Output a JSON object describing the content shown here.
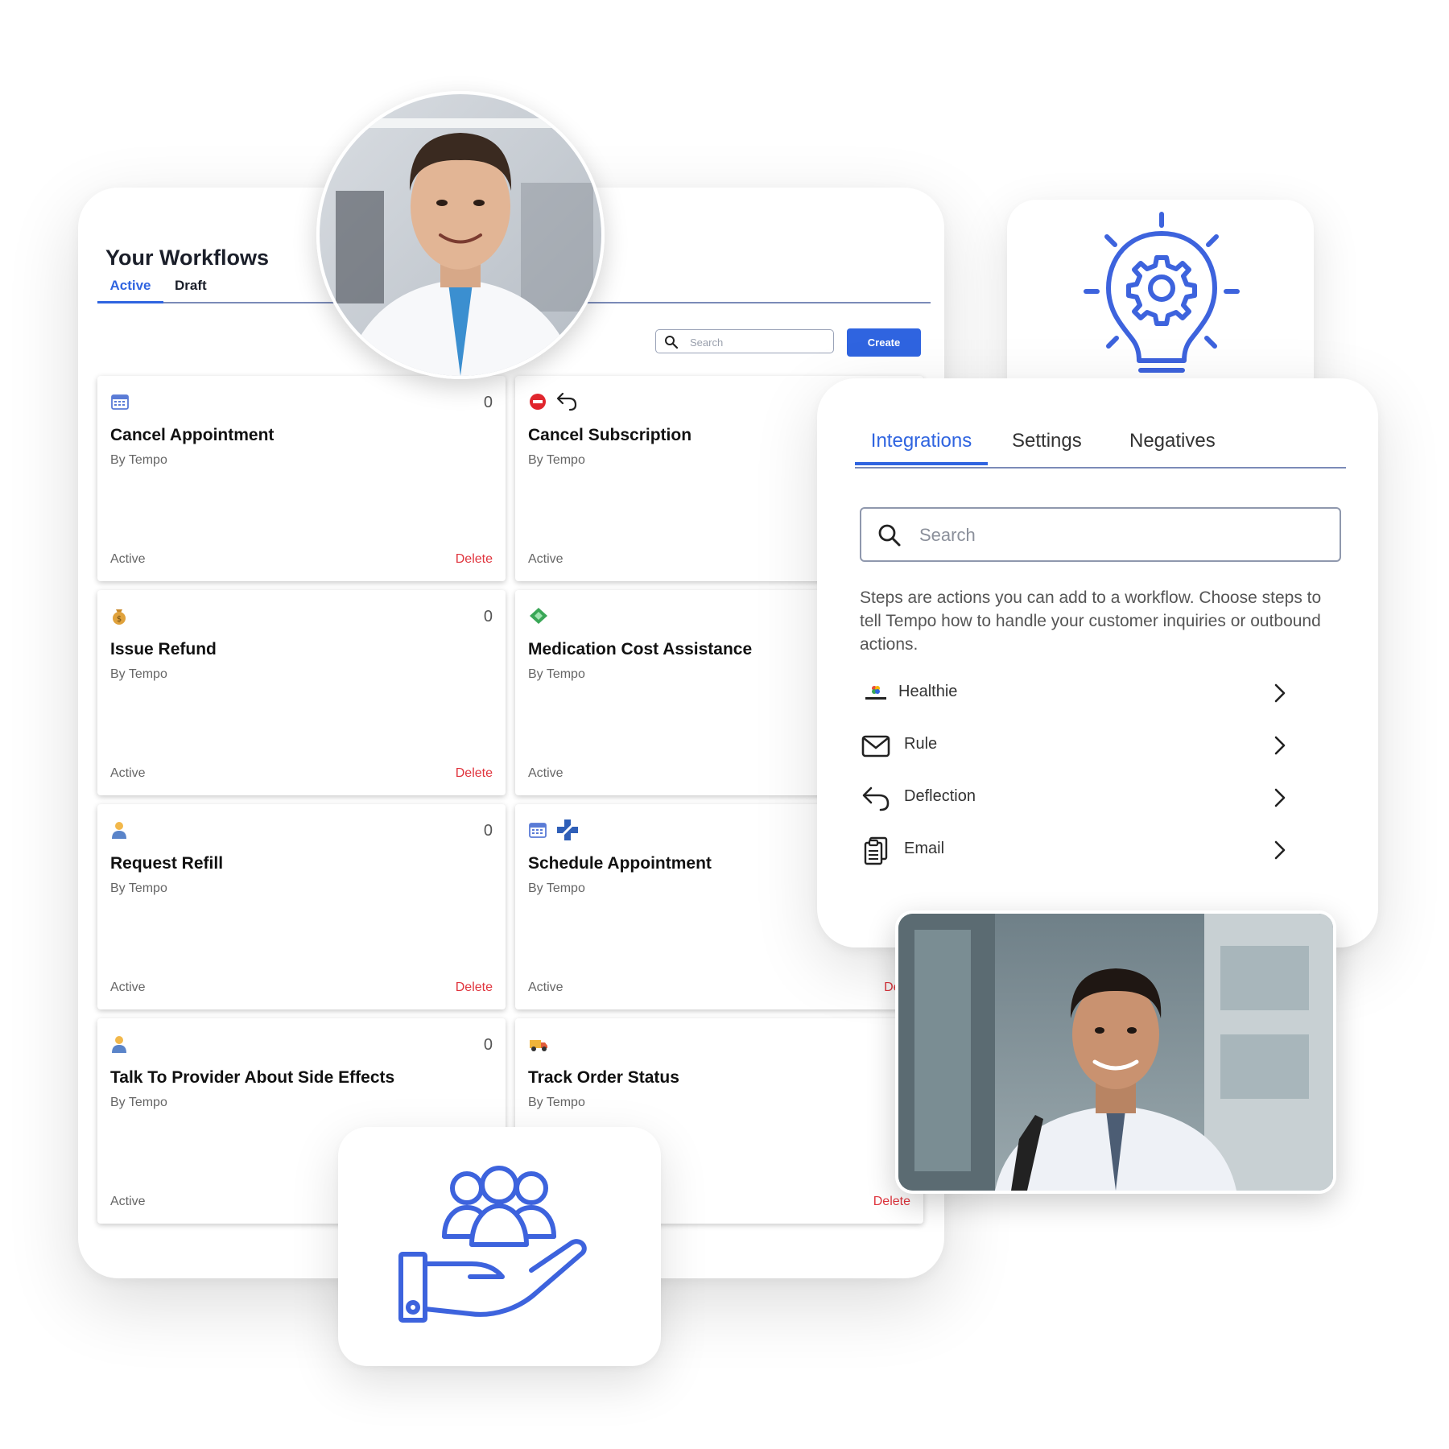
{
  "workflows": {
    "title": "Your Workflows",
    "tabs": {
      "active": "Active",
      "draft": "Draft"
    },
    "search_placeholder": "Search",
    "create_label": "Create",
    "cards": [
      {
        "title": "Cancel Appointment",
        "by": "By Tempo",
        "count": "0",
        "status": "Active",
        "delete": "Delete",
        "icons": [
          "calendar-icon"
        ]
      },
      {
        "title": "Cancel Subscription",
        "by": "By Tempo",
        "count": "",
        "status": "Active",
        "delete": "",
        "icons": [
          "no-entry-icon",
          "undo-arrow-icon"
        ]
      },
      {
        "title": "Issue Refund",
        "by": "By Tempo",
        "count": "0",
        "status": "Active",
        "delete": "Delete",
        "icons": [
          "money-bag-icon"
        ]
      },
      {
        "title": "Medication Cost Assistance",
        "by": "By Tempo",
        "count": "",
        "status": "Active",
        "delete": "",
        "icons": [
          "money-diamond-icon"
        ]
      },
      {
        "title": "Request Refill",
        "by": "By Tempo",
        "count": "0",
        "status": "Active",
        "delete": "Delete",
        "icons": [
          "person-icon"
        ]
      },
      {
        "title": "Schedule Appointment",
        "by": "By Tempo",
        "count": "",
        "status": "Active",
        "delete": "Dele",
        "icons": [
          "calendar-icon",
          "medical-cross-icon"
        ]
      },
      {
        "title": "Talk To Provider About Side Effects",
        "by": "By Tempo",
        "count": "0",
        "status": "Active",
        "delete": "",
        "icons": [
          "person-icon"
        ]
      },
      {
        "title": "Track Order Status",
        "by": "By Tempo",
        "count": "",
        "status": "",
        "delete": "Delete",
        "icons": [
          "delivery-truck-icon"
        ]
      }
    ]
  },
  "integrations": {
    "tabs": [
      "Integrations",
      "Settings",
      "Negatives"
    ],
    "search_placeholder": "Search",
    "description": "Steps are actions you can add to a workflow. Choose steps to tell Tempo how to handle your customer inquiries or outbound actions.",
    "items": [
      {
        "label": "Healthie",
        "icon": "healthie-logo-icon"
      },
      {
        "label": "Rule",
        "icon": "envelope-icon"
      },
      {
        "label": "Deflection",
        "icon": "undo-arrow-icon"
      },
      {
        "label": "Email",
        "icon": "clipboard-icon"
      }
    ]
  },
  "decor": {
    "bulb_icon": "lightbulb-gear-icon",
    "hand_icon": "hand-holding-people-icon",
    "accent_color": "#2f64e0",
    "icon_color": "#3d63dd",
    "delete_color": "#e0343d"
  }
}
